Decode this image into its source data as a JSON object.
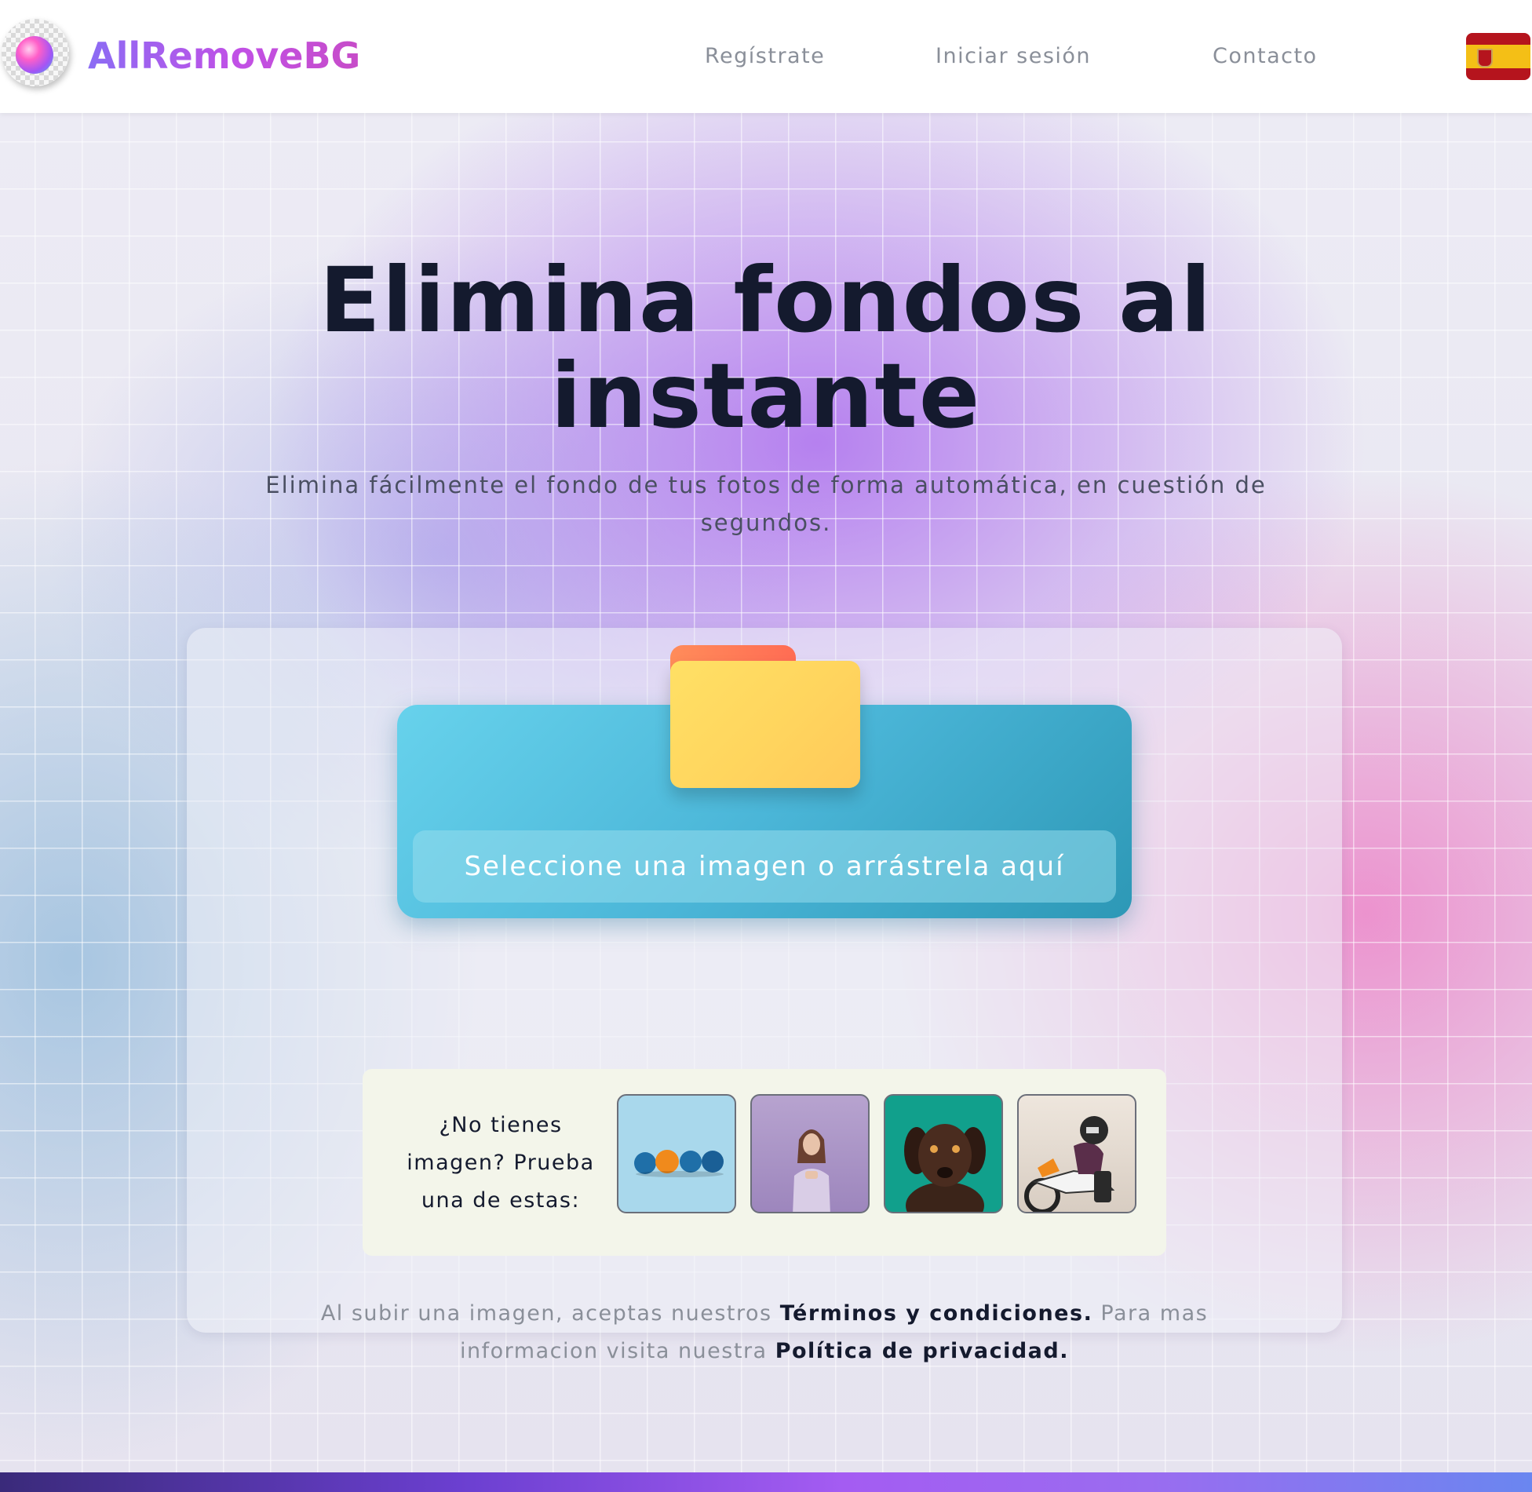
{
  "header": {
    "brand": "AllRemoveBG",
    "nav": {
      "register": "Regístrate",
      "login": "Iniciar sesión",
      "contact": "Contacto"
    },
    "language_flag": "spain-flag-icon"
  },
  "hero": {
    "title_line1": "Elimina fondos al",
    "title_line2": "instante",
    "subtitle": "Elimina fácilmente el fondo de tus fotos de forma automática, en cuestión de segundos."
  },
  "upload": {
    "button_label": "Seleccione una imagen o arrástrela aquí",
    "icon": "folder-icon"
  },
  "samples": {
    "prompt": "¿No tienes imagen? Prueba una de estas:",
    "images": [
      "sample-balls",
      "sample-woman",
      "sample-dog",
      "sample-motorcycle"
    ]
  },
  "terms": {
    "text1": "Al subir una imagen, aceptas nuestros",
    "link_terms": "Términos y condiciones.",
    "text2": "Para mas informacion visita nuestra",
    "link_privacy": "Política de privacidad."
  },
  "colors": {
    "brand_start": "#8b6cf4",
    "brand_end": "#c74cc8",
    "upload_blue": "#4bb6d8",
    "title": "#141a2e"
  }
}
